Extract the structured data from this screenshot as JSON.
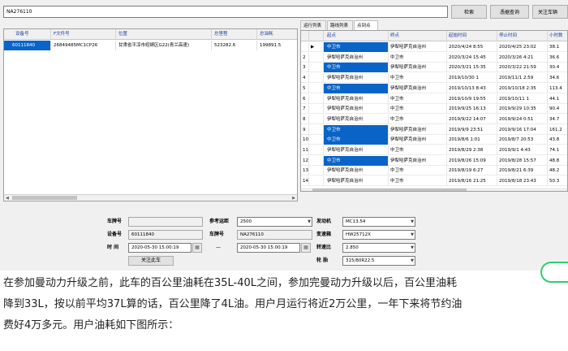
{
  "search": {
    "value": "NA276110"
  },
  "buttons": {
    "search": "检索",
    "history": "憑据查询",
    "follow": "关注车辆",
    "follow_car": "关注此车"
  },
  "left_table": {
    "columns": [
      "设备号",
      "F文件号",
      "位置",
      "总里程",
      "总油耗"
    ],
    "rows": [
      [
        "60111840",
        "26849485MC1CP26",
        "甘肃省平凉市崆峒区G22(青兰高速)",
        "523282.6",
        "199891.5"
      ]
    ]
  },
  "tabs": [
    "运行列表",
    "路线列表",
    "点到点"
  ],
  "right_table": {
    "columns": [
      "起点",
      "终点",
      "起始时间",
      "停止时间",
      "小时数"
    ],
    "rows": [
      {
        "n": "",
        "icon": "▶",
        "origin": "中卫市",
        "dest": "伊犁哈萨克自治州",
        "start": "2020/4/24 8:55",
        "end": "2020/4/25 23:02",
        "hours": "38.1"
      },
      {
        "n": "2",
        "icon": "",
        "origin": "伊犁哈萨克自治州",
        "dest": "中卫市",
        "start": "2020/3/24 15:45",
        "end": "2020/3/26 4:21",
        "hours": "36.6"
      },
      {
        "n": "3",
        "icon": "",
        "origin": "中卫市",
        "dest": "伊犁哈萨克自治州",
        "start": "2020/3/21 15:35",
        "end": "2020/3/22 21:59",
        "hours": "30.4"
      },
      {
        "n": "4",
        "icon": "",
        "origin": "伊犁哈萨克自治州",
        "dest": "中卫市",
        "start": "2019/10/30 1",
        "end": "2019/11/1 2:59",
        "hours": "34.6"
      },
      {
        "n": "5",
        "icon": "",
        "origin": "中卫市",
        "dest": "伊犁哈萨克自治州",
        "start": "2019/10/13 8:43",
        "end": "2019/10/18 2:35",
        "hours": "113.4"
      },
      {
        "n": "6",
        "icon": "",
        "origin": "伊犁哈萨克自治州",
        "dest": "中卫市",
        "start": "2019/10/9 19:55",
        "end": "2019/10/11 1",
        "hours": "44.1"
      },
      {
        "n": "7",
        "icon": "",
        "origin": "伊犁哈萨克自治州",
        "dest": "中卫市",
        "start": "2019/9/25 16:13",
        "end": "2019/9/29 10:35",
        "hours": "90.4"
      },
      {
        "n": "8",
        "icon": "",
        "origin": "伊犁哈萨克自治州",
        "dest": "中卫市",
        "start": "2019/9/22 14:07",
        "end": "2019/9/24 0:51",
        "hours": "34.7"
      },
      {
        "n": "9",
        "icon": "",
        "origin": "中卫市",
        "dest": "伊犁哈萨克自治州",
        "start": "2019/9/9 23:51",
        "end": "2019/9/16 17:04",
        "hours": "161.2"
      },
      {
        "n": "10",
        "icon": "",
        "origin": "中卫市",
        "dest": "伊犁哈萨克自治州",
        "start": "2019/8/6 1:01",
        "end": "2019/8/7 20:53",
        "hours": "43.8"
      },
      {
        "n": "11",
        "icon": "",
        "origin": "伊犁哈萨克自治州",
        "dest": "中卫市",
        "start": "2019/8/29 2:38",
        "end": "2019/9/1 4:43",
        "hours": "74.1"
      },
      {
        "n": "12",
        "icon": "",
        "origin": "中卫市",
        "dest": "伊犁哈萨克自治州",
        "start": "2019/8/26 15:09",
        "end": "2019/8/28 15:57",
        "hours": "48.8"
      },
      {
        "n": "13",
        "icon": "",
        "origin": "伊犁哈萨克自治州",
        "dest": "中卫市",
        "start": "2019/8/19 6:27",
        "end": "2019/8/21 6:39",
        "hours": "48.2"
      },
      {
        "n": "14",
        "icon": "",
        "origin": "伊犁哈萨克自治州",
        "dest": "中卫市",
        "start": "2019/8/16 21:25",
        "end": "2019/8/18 23:43",
        "hours": "50.3"
      }
    ]
  },
  "form": {
    "plate_label": "车牌号",
    "params_label": "参考运距",
    "params_value": "2500",
    "engine_label": "发动机",
    "engine_value": "MC13.54",
    "device_label": "设备号",
    "device_value": "60111840",
    "plate2_label": "车牌号",
    "plate2_value": "NA276110",
    "gearbox_label": "变速箱",
    "gearbox_value": "HW25712X",
    "time_label": "时   间",
    "time_from": "2020-05-30 15:00:19",
    "time_sep": "—",
    "time_to": "2020-05-30 15:00:19",
    "ratio_label": "转速比",
    "ratio_value": "2.850",
    "tire_label": "轮   胎",
    "tire_value": "315/80R22.5"
  },
  "article": {
    "line1": "在参加曼动力升级之前，此车的百公里油耗在35L-40L之间，参加完曼动力升级以后，百公里油耗",
    "line2": "降到33L，按以前平均37L算的话，百公里降了4L油。用户月运行将近2万公里，一年下来将节约油",
    "line3": "费好4万多元。用户油耗如下图所示："
  },
  "colors": {
    "selection": "#0a64c8",
    "header_text": "#1f3f9f",
    "fab_ring": "#2ecc71"
  }
}
